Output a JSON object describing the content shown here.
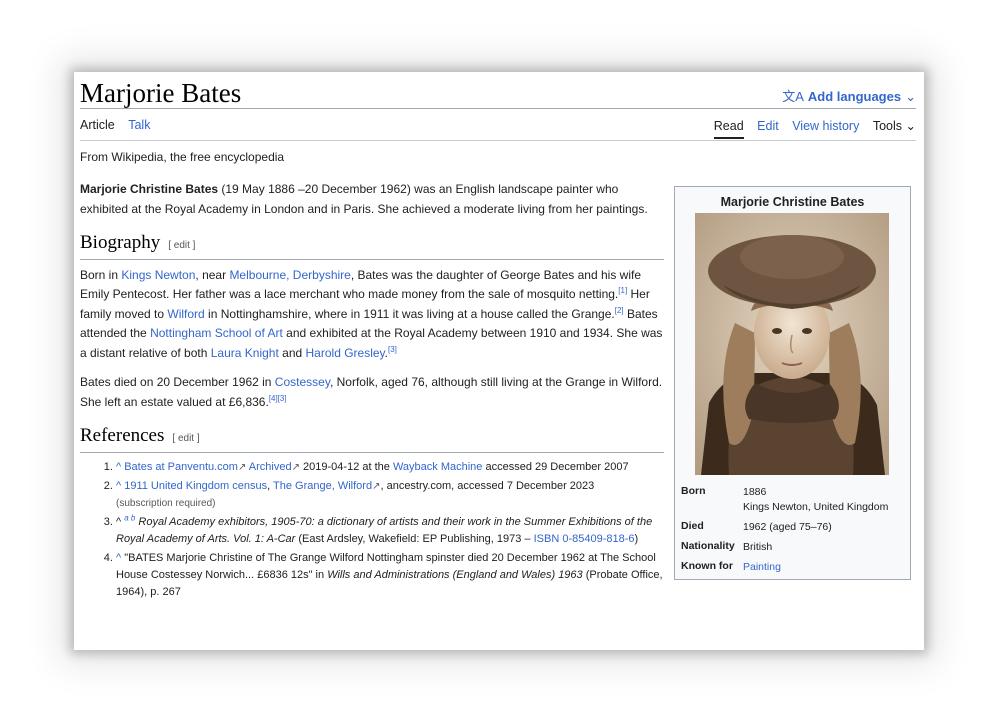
{
  "page": {
    "title": "Marjorie Bates",
    "add_languages": "Add languages",
    "tagline": "From Wikipedia, the free encyclopedia"
  },
  "tabs": {
    "article": "Article",
    "talk": "Talk",
    "read": "Read",
    "edit": "Edit",
    "history": "View history",
    "tools": "Tools"
  },
  "lead": {
    "name": "Marjorie Christine Bates",
    "text": " (19 May 1886 –20 December 1962) was an English landscape painter who exhibited at the Royal Academy in London and in Paris. She achieved a moderate living from her paintings."
  },
  "biography": {
    "heading": "Biography",
    "edit": "[ edit ]",
    "p1": {
      "t1": "Born in ",
      "l1": "Kings Newton",
      "t2": ", near ",
      "l2": "Melbourne, Derbyshire",
      "t3": ", Bates was the daughter of George Bates and his wife Emily Pentecost. Her father was a lace merchant who made money from the sale of mosquito netting.",
      "r1": "[1]",
      "t4": " Her family moved to ",
      "l3": "Wilford",
      "t5": " in Nottinghamshire, where in 1911 it was living at a house called the Grange.",
      "r2": "[2]",
      "t6": " Bates attended the ",
      "l4": "Nottingham School of Art",
      "t7": " and exhibited at the Royal Academy between 1910 and 1934. She was a distant relative of both ",
      "l5": "Laura Knight",
      "t8": " and ",
      "l6": "Harold Gresley",
      "t9": ".",
      "r3": "[3]"
    },
    "p2": {
      "t1": "Bates died on 20 December 1962 in ",
      "l1": "Costessey",
      "t2": ", Norfolk, aged 76, although still living at the Grange in Wilford. She left an estate valued at £6,836.",
      "r1": "[4][3]"
    }
  },
  "references": {
    "heading": "References",
    "edit": "[ edit ]",
    "items": [
      {
        "caret": "^ ",
        "l1": "Bates at Panventu.com",
        "l2": "Archived",
        "t1": " 2019-04-12 at the ",
        "l3": "Wayback Machine",
        "t2": " accessed 29 December 2007"
      },
      {
        "caret": "^ ",
        "l1": "1911 United Kingdom census",
        "t1": ", ",
        "l2": "The Grange, Wilford",
        "t2": ", ancestry.com, accessed 7 December 2023",
        "small": "(subscription required)"
      },
      {
        "caret": "^ ",
        "ab": "a b",
        "i1": " Royal Academy exhibitors, 1905-70: a dictionary of artists and their work in the Summer Exhibitions of the Royal Academy of Arts. Vol. 1: A-Car",
        "t1": " (East Ardsley, Wakefield: EP Publishing, 1973 – ",
        "l1": "ISBN 0-85409-818-6",
        "t2": ")"
      },
      {
        "caret": "^ ",
        "t1": "\"BATES Marjorie Christine of The Grange Wilford Nottingham spinster died 20 December 1962 at The School House Costessey Norwich... £6836 12s\" in ",
        "i1": "Wills and Administrations (England and Wales) 1963",
        "t2": " (Probate Office, 1964), p. 267"
      }
    ]
  },
  "infobox": {
    "title": "Marjorie Christine Bates",
    "born_label": "Born",
    "born_year": "1886",
    "born_place": "Kings Newton, United Kingdom",
    "died_label": "Died",
    "died_value": "1962 (aged 75–76)",
    "nationality_label": "Nationality",
    "nationality_value": "British",
    "known_label": "Known for",
    "known_value": "Painting"
  },
  "icons": {
    "translate": "translate-icon",
    "chevron": "chevron-down-icon",
    "external": "external-link-icon"
  }
}
